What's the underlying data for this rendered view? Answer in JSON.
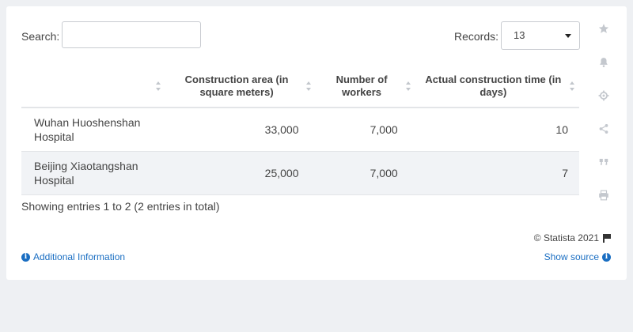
{
  "search": {
    "label": "Search:",
    "value": "",
    "placeholder": ""
  },
  "records": {
    "label": "Records:",
    "selected": "13"
  },
  "table": {
    "headers": [
      "",
      "Construction area (in square meters)",
      "Number of workers",
      "Actual construction time (in days)"
    ],
    "rows": [
      [
        "Wuhan Huoshenshan Hospital",
        "33,000",
        "7,000",
        "10"
      ],
      [
        "Beijing Xiaotangshan Hospital",
        "25,000",
        "7,000",
        "7"
      ]
    ]
  },
  "footer": {
    "showing": "Showing entries 1 to 2 (2 entries in total)",
    "copyright": "© Statista 2021",
    "additional_info": "Additional Information",
    "show_source": "Show source"
  },
  "icons": {
    "star": "star-icon",
    "bell": "bell-icon",
    "gear": "gear-icon",
    "share": "share-icon",
    "quote": "quote-icon",
    "print": "print-icon",
    "info": "info-icon",
    "flag": "flag-icon"
  },
  "colors": {
    "background": "#eef0f3",
    "card": "#ffffff",
    "link": "#1a6ec2",
    "icon": "#c4c8ce",
    "row_alt": "#f1f3f6"
  }
}
